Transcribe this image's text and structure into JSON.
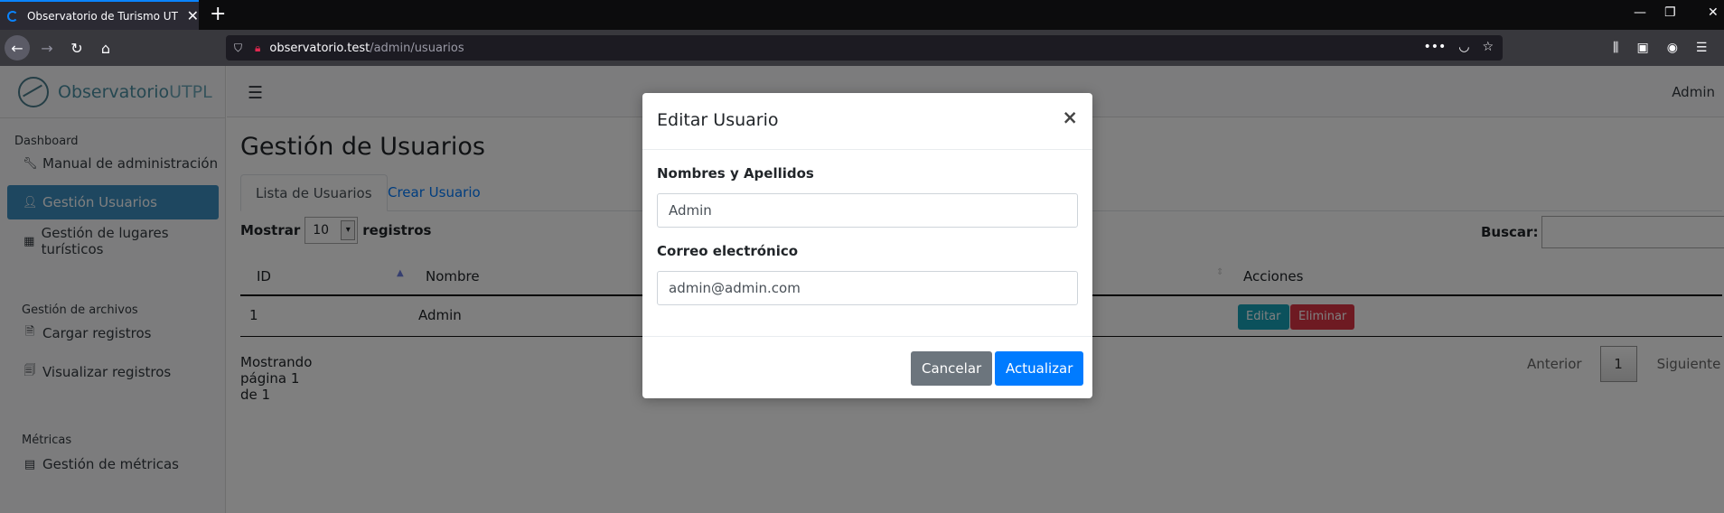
{
  "browser": {
    "tab_title": "Observatorio de Turismo UTPL",
    "url_host": "observatorio.test",
    "url_path": "/admin/usuarios"
  },
  "sidebar": {
    "brand_main": "Observatorio",
    "brand_suffix": "UTPL",
    "sections": [
      {
        "label": "Dashboard"
      },
      {
        "label": "Gestión de archivos"
      },
      {
        "label": "Métricas"
      }
    ],
    "items": [
      {
        "label": "Manual de administración",
        "icon": "wrench-icon"
      },
      {
        "label": "Gestión Usuarios",
        "icon": "user-icon",
        "active": true
      },
      {
        "label": "Gestión de lugares turísticos",
        "icon": "building-icon"
      },
      {
        "label": "Cargar registros",
        "icon": "file-upload-icon"
      },
      {
        "label": "Visualizar registros",
        "icon": "file-text-icon"
      },
      {
        "label": "Gestión de métricas",
        "icon": "calculator-icon"
      }
    ]
  },
  "topbar": {
    "user": "Admin"
  },
  "main": {
    "title": "Gestión de Usuarios",
    "tabs": [
      {
        "label": "Lista de Usuarios",
        "active": true
      },
      {
        "label": "Crear Usuario"
      }
    ],
    "length": {
      "prefix": "Mostrar",
      "value": "10",
      "suffix": "registros"
    },
    "search_label": "Buscar:",
    "table": {
      "columns": [
        "ID",
        "Nombre",
        "Acciones"
      ],
      "rows": [
        {
          "id": "1",
          "name": "Admin"
        }
      ],
      "edit_label": "Editar",
      "delete_label": "Eliminar"
    },
    "info": "Mostrando página 1 de 1",
    "pager": {
      "prev": "Anterior",
      "current": "1",
      "next": "Siguiente"
    }
  },
  "modal": {
    "title": "Editar Usuario",
    "close": "×",
    "name_label": "Nombres y Apellidos",
    "name_value": "Admin",
    "email_label": "Correo electrónico",
    "email_value": "admin@admin.com",
    "cancel_label": "Cancelar",
    "update_label": "Actualizar"
  },
  "colors": {
    "primary": "#007bff",
    "info": "#17a2b8",
    "danger": "#dc3545",
    "secondary": "#6c757d",
    "sidebar_active": "#3d8fc0"
  }
}
